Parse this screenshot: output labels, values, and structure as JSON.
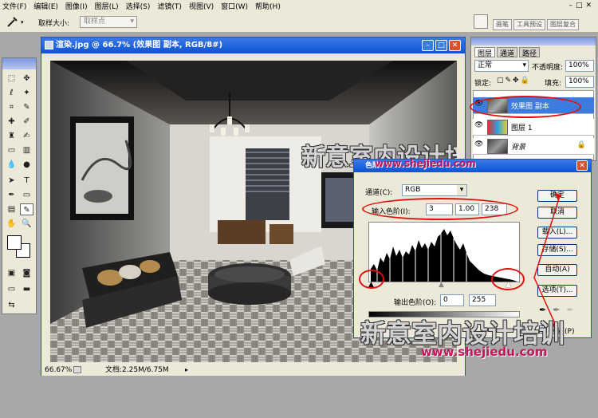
{
  "menu": [
    "文件(F)",
    "编辑(E)",
    "图像(I)",
    "图层(L)",
    "选择(S)",
    "滤镜(T)",
    "视图(V)",
    "窗口(W)",
    "帮助(H)"
  ],
  "options": {
    "sample_size_label": "取样大小:",
    "sample_size_value": "取样点",
    "panel_tabs": [
      "画笔",
      "工具预设",
      "图层复合"
    ]
  },
  "image_window": {
    "title": "渲染.jpg @ 66.7% (效果图 副本, RGB/8#)",
    "zoom": "66.67%",
    "doc_info": "文档:2.25M/6.75M"
  },
  "layers_panel": {
    "tabs": [
      "图层",
      "通道",
      "路径"
    ],
    "blend_mode": "正常",
    "opacity_label": "不透明度:",
    "opacity_value": "100%",
    "lock_label": "锁定:",
    "fill_label": "填充:",
    "fill_value": "100%",
    "layers": [
      {
        "name": "效果图 副本",
        "selected": true
      },
      {
        "name": "图层 1",
        "selected": false
      },
      {
        "name": "背景",
        "selected": false
      }
    ]
  },
  "levels": {
    "title": "色阶",
    "channel_label": "通道(C):",
    "channel_value": "RGB",
    "input_label": "输入色阶(I):",
    "input_black": "3",
    "input_gamma": "1.00",
    "input_white": "238",
    "output_label": "输出色阶(O):",
    "output_black": "0",
    "output_white": "255",
    "buttons": {
      "ok": "确定",
      "cancel": "取消",
      "load": "载入(L)...",
      "save": "存储(S)...",
      "auto": "自动(A)",
      "options": "选项(T)..."
    },
    "preview_label": "预览(P)"
  },
  "watermark": {
    "brand": "新意室内设计培训",
    "url": "www.shejiedu.com"
  },
  "colors": {
    "xp_blue": "#0b54d4",
    "selected_layer": "#3d7cdd",
    "annotation_red": "#e01010"
  }
}
